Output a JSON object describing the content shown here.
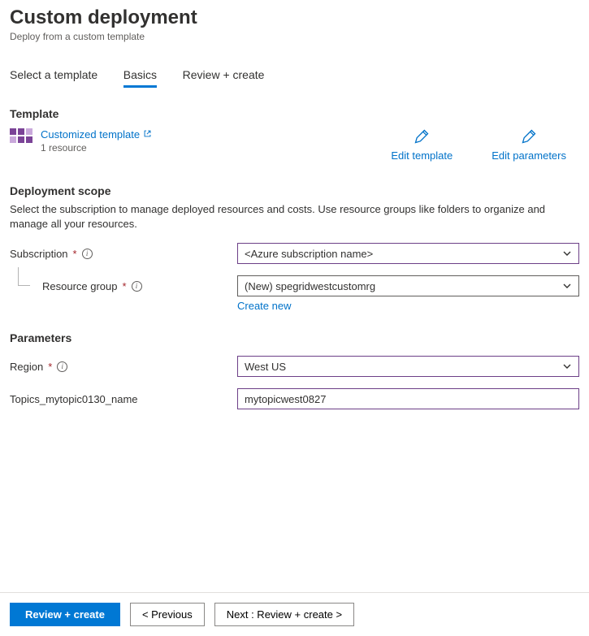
{
  "header": {
    "title": "Custom deployment",
    "subtitle": "Deploy from a custom template"
  },
  "tabs": [
    {
      "label": "Select a template",
      "active": false
    },
    {
      "label": "Basics",
      "active": true
    },
    {
      "label": "Review + create",
      "active": false
    }
  ],
  "template": {
    "heading": "Template",
    "link_label": "Customized template",
    "resource_count": "1 resource",
    "edit_template_label": "Edit template",
    "edit_parameters_label": "Edit parameters"
  },
  "deployment_scope": {
    "heading": "Deployment scope",
    "description": "Select the subscription to manage deployed resources and costs. Use resource groups like folders to organize and manage all your resources.",
    "subscription": {
      "label": "Subscription",
      "value": "<Azure subscription name>"
    },
    "resource_group": {
      "label": "Resource group",
      "value": "(New) spegridwestcustomrg",
      "create_new_label": "Create new"
    }
  },
  "parameters": {
    "heading": "Parameters",
    "region": {
      "label": "Region",
      "value": "West US"
    },
    "topic_name": {
      "label": "Topics_mytopic0130_name",
      "value": "mytopicwest0827"
    }
  },
  "footer": {
    "review_create": "Review + create",
    "previous": "< Previous",
    "next": "Next : Review + create >"
  }
}
